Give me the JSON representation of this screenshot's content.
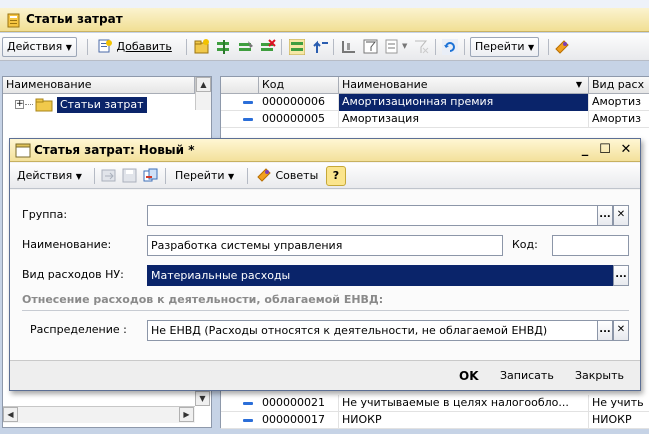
{
  "outer_window": {
    "title": "Статьи затрат",
    "toolbar": {
      "actions_label": "Действия",
      "add_label": "Добавить",
      "goto_label": "Перейти"
    }
  },
  "tree": {
    "header": "Наименование",
    "root_label": "Статьи затрат"
  },
  "grid": {
    "columns": [
      "Код",
      "Наименование",
      "Вид расх"
    ],
    "rows": [
      {
        "code": "000000006",
        "name": "Амортизационная премия",
        "kind": "Амортиз",
        "selected": true
      },
      {
        "code": "000000005",
        "name": "Амортизация",
        "kind": "Амортиз",
        "selected": false
      },
      {
        "code": "000000021",
        "name": "Не учитываемые в целях налогообло...",
        "kind": "Не учить",
        "selected": false
      },
      {
        "code": "000000017",
        "name": "НИОКР",
        "kind": "НИОКР",
        "selected": false
      }
    ]
  },
  "dialog": {
    "title": "Статья затрат: Новый *",
    "toolbar": {
      "actions_label": "Действия",
      "goto_label": "Перейти",
      "advice_label": "Советы"
    },
    "fields": {
      "group_label": "Группа:",
      "group_value": "",
      "name_label": "Наименование:",
      "name_value": "Разработка системы управления",
      "code_label": "Код:",
      "code_value": "",
      "expense_kind_label": "Вид расходов НУ:",
      "expense_kind_value": "Материальные расходы",
      "section_title": "Отнесение расходов к деятельности, облагаемой ЕНВД:",
      "distribution_label": "Распределение :",
      "distribution_value": "Не ЕНВД (Расходы относятся к деятельности, не облагаемой ЕНВД)"
    },
    "footer": {
      "ok_label": "OK",
      "save_label": "Записать",
      "close_label": "Закрыть"
    }
  },
  "colors": {
    "selection": "#0a246a",
    "title_bar": "#f3e19b",
    "section_title": "#8a8a8a"
  }
}
